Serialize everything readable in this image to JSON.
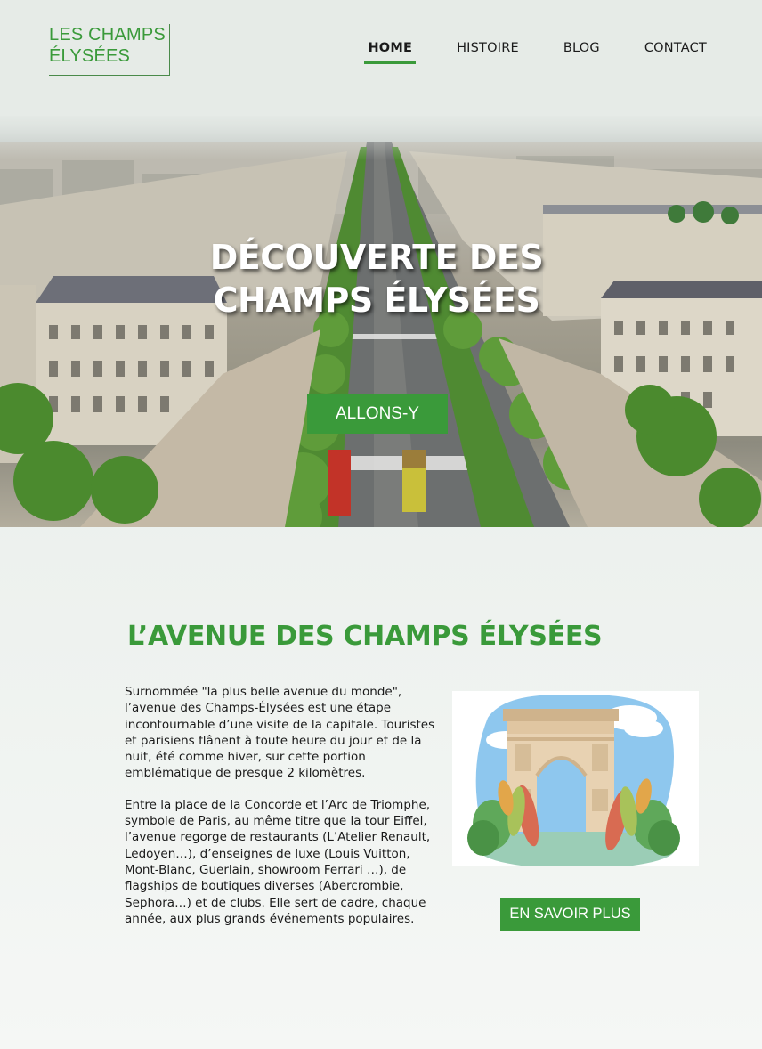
{
  "logo": {
    "line1": "LES CHAMPS",
    "line2": "ÉLYSÉES"
  },
  "nav": {
    "items": [
      {
        "label": "HOME",
        "active": true
      },
      {
        "label": "HISTOIRE"
      },
      {
        "label": "BLOG"
      },
      {
        "label": "CONTACT"
      }
    ]
  },
  "hero": {
    "title_line1": "DÉCOUVERTE DES",
    "title_line2": "CHAMPS ÉLYSÉES",
    "button_label": "ALLONS-Y"
  },
  "section": {
    "title": "L’AVENUE DES CHAMPS ÉLYSÉES",
    "paragraph1": "Surnommée \"la plus belle avenue du monde\", l’avenue des Champs-Élysées est une étape incontournable d’une visite de la capitale. Touristes et parisiens flânent à toute heure du jour et de la nuit, été comme hiver, sur cette portion emblématique de presque 2 kilomètres.",
    "paragraph2": "Entre la place de la Concorde et l’Arc de Triomphe, symbole de Paris, au même titre que la tour Eiffel, l’avenue regorge de restaurants (L’Atelier Renault, Ledoyen…), d’enseignes de luxe (Louis Vuitton, Mont-Blanc, Guerlain, showroom Ferrari …), de flagships de boutiques diverses (Abercrombie, Sephora…) et de clubs. Elle sert de cadre, chaque année, aux plus grands événements populaires.",
    "button_label": "EN SAVOIR PLUS"
  },
  "colors": {
    "accent": "#3a9a3a",
    "background": "#e6ebe7"
  }
}
